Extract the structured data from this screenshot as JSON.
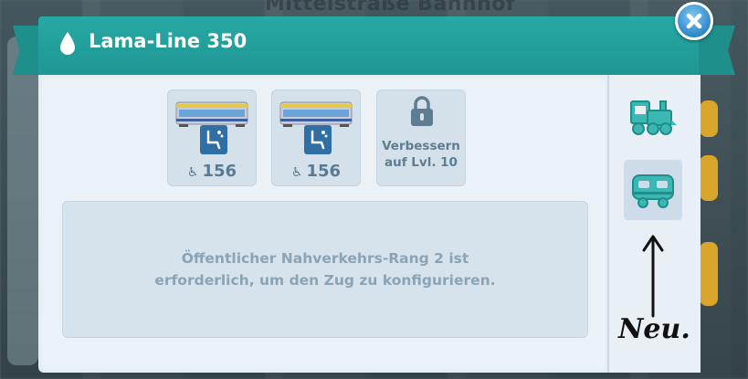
{
  "header": {
    "title": "Lama-Line 350",
    "background_title": "Mittelstraße Bahnhof"
  },
  "slots": [
    {
      "type": "wagon",
      "capacity": "156"
    },
    {
      "type": "wagon",
      "capacity": "156"
    },
    {
      "type": "locked",
      "line1": "Verbessern",
      "line2": "auf Lvl. 10"
    }
  ],
  "info": {
    "line1": "Öffentlicher Nahverkehrs-Rang 2 ist",
    "line2": "erforderlich, um den Zug zu konfigurieren."
  },
  "sidebar": {
    "tabs": [
      "locomotive-tab",
      "wagon-tab"
    ],
    "active_tab": "wagon-tab"
  },
  "annotation": {
    "text": "Neu."
  },
  "colors": {
    "header": "#1f9793",
    "badge": "#2f6fa3",
    "icon_teal": "#3cb8b4"
  }
}
